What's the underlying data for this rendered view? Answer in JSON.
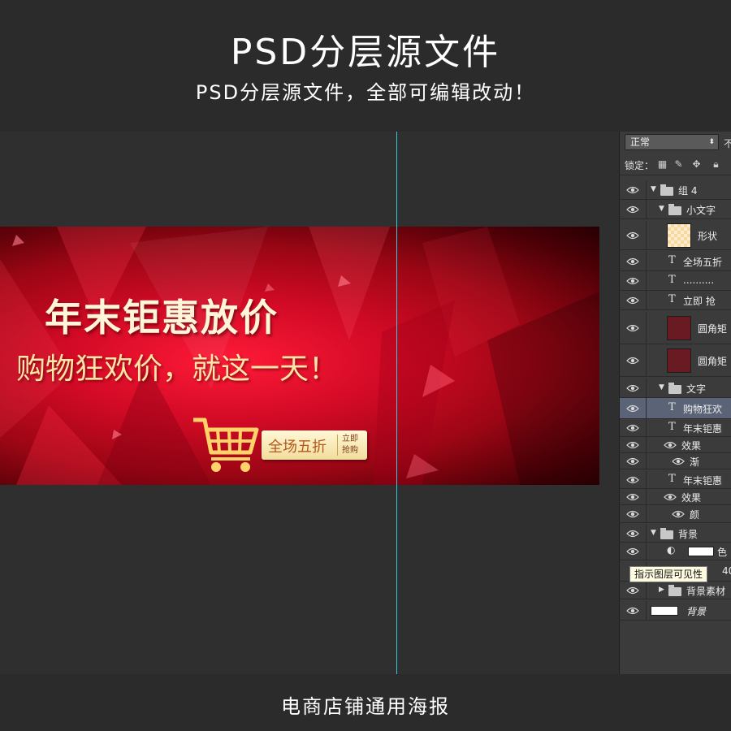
{
  "header": {
    "title": "PSD分层源文件",
    "subtitle": "PSD分层源文件，全部可编辑改动！"
  },
  "banner": {
    "headline": "年末钜惠放价",
    "tagline": "购物狂欢价，就这一天！",
    "badge_main": "全场五折",
    "badge_small_1": "立即",
    "badge_small_2": "抢购",
    "cart_icon": "shopping-cart-icon"
  },
  "layers_panel": {
    "blend_mode": "正常",
    "opacity_label": "不",
    "lock_label": "锁定：",
    "layers": [
      {
        "name": "组 4",
        "kind": "group"
      },
      {
        "name": "小文字",
        "kind": "group"
      },
      {
        "name": "形状",
        "kind": "shape"
      },
      {
        "name": "全场五折",
        "kind": "text"
      },
      {
        "name": "..........",
        "kind": "text"
      },
      {
        "name": "立即 抢",
        "kind": "text"
      },
      {
        "name": "圆角矩",
        "kind": "shape"
      },
      {
        "name": "圆角矩",
        "kind": "shape"
      },
      {
        "name": "文字",
        "kind": "group"
      },
      {
        "name": "购物狂欢",
        "kind": "text",
        "selected": true
      },
      {
        "name": "年末钜惠",
        "kind": "text"
      },
      {
        "name": "效果",
        "kind": "effect"
      },
      {
        "name": "渐",
        "kind": "effect"
      },
      {
        "name": "年末钜惠",
        "kind": "text"
      },
      {
        "name": "效果",
        "kind": "effect"
      },
      {
        "name": "颜",
        "kind": "effect"
      },
      {
        "name": "背景",
        "kind": "group"
      },
      {
        "name": "色",
        "kind": "adjustment"
      },
      {
        "name": "40",
        "kind": "layer"
      },
      {
        "name": "背景素材",
        "kind": "group"
      },
      {
        "name": "背景",
        "kind": "background"
      }
    ],
    "tooltip": "指示图层可见性"
  },
  "footer": {
    "caption": "电商店铺通用海报"
  },
  "colors": {
    "banner_red": "#d10a25",
    "guide_cyan": "#38c8d8",
    "panel_bg": "#3b3b3b",
    "selected_layer": "#5a6476"
  }
}
